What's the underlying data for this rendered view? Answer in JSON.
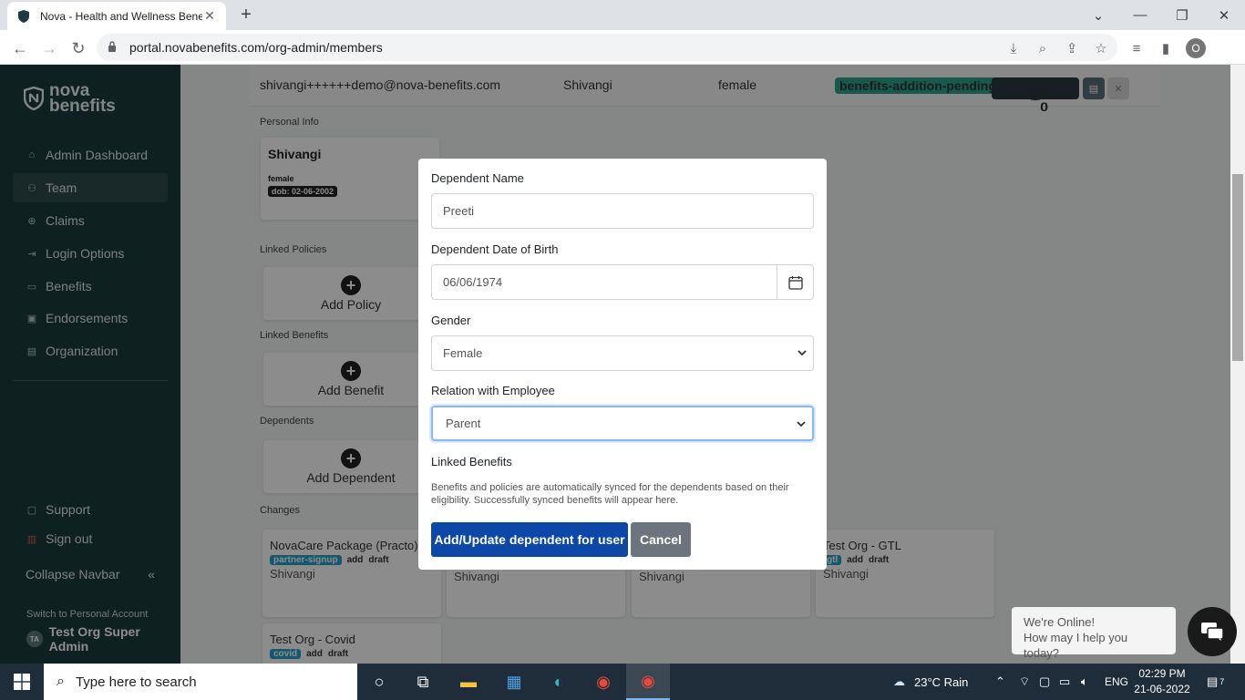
{
  "browser": {
    "tab_title": "Nova - Health and Wellness Bene",
    "url": "portal.novabenefits.com/org-admin/members",
    "profile_initial": "O"
  },
  "sidebar": {
    "logo_line1": "nova",
    "logo_line2": "benefits",
    "items": [
      {
        "label": "Admin Dashboard",
        "icon": "home-icon"
      },
      {
        "label": "Team",
        "icon": "team-icon"
      },
      {
        "label": "Claims",
        "icon": "claims-icon"
      },
      {
        "label": "Login Options",
        "icon": "login-icon"
      },
      {
        "label": "Benefits",
        "icon": "benefits-icon"
      },
      {
        "label": "Endorsements",
        "icon": "endorsements-icon"
      },
      {
        "label": "Organization",
        "icon": "organization-icon"
      }
    ],
    "support": "Support",
    "signout": "Sign out",
    "collapse": "Collapse Navbar",
    "collapse_icon": "«",
    "switch_label": "Switch to Personal Account",
    "account_initials": "TA",
    "account_name": "Test Org Super Admin"
  },
  "member_row": {
    "email": "shivangi++++++demo@nova-benefits.com",
    "name": "Shivangi",
    "gender": "female",
    "status": "benefits-addition-pending",
    "counts": [
      "0",
      "0",
      "0"
    ]
  },
  "personal": {
    "section": "Personal Info",
    "name": "Shivangi",
    "gender": "female",
    "dob": "dob: 02-06-2002"
  },
  "sections": {
    "linked_policies": "Linked Policies",
    "add_policy": "Add Policy",
    "linked_benefits": "Linked Benefits",
    "add_benefit": "Add Benefit",
    "dependents": "Dependents",
    "add_dependent": "Add Dependent",
    "changes": "Changes"
  },
  "changes": [
    {
      "title": "NovaCare Package (Practo)",
      "tag": "partner-signup",
      "op": "add",
      "state": "draft",
      "user": "Shivangi"
    },
    {
      "title": "",
      "tag": "",
      "op": "",
      "state": "",
      "user": "Shivangi"
    },
    {
      "title": "",
      "tag": "",
      "op": "",
      "state": "",
      "user": "Shivangi"
    },
    {
      "title": "Test Org - GTL",
      "tag": "gtl",
      "op": "add",
      "state": "draft",
      "user": "Shivangi"
    },
    {
      "title": "Test Org - Covid",
      "tag": "covid",
      "op": "add",
      "state": "draft",
      "user": ""
    }
  ],
  "modal": {
    "name_label": "Dependent Name",
    "name_value": "Preeti",
    "dob_label": "Dependent Date of Birth",
    "dob_value": "06/06/1974",
    "gender_label": "Gender",
    "gender_value": "Female",
    "relation_label": "Relation with Employee",
    "relation_value": "Parent",
    "linked_label": "Linked Benefits",
    "linked_help": "Benefits and policies are automatically synced for the dependents based on their eligibility. Successfully synced benefits will appear here.",
    "submit": "Add/Update dependent for user",
    "cancel": "Cancel"
  },
  "chat": {
    "line1": "We're Online!",
    "line2": "How may I help you today?"
  },
  "taskbar": {
    "search_placeholder": "Type here to search",
    "weather": "23°C  Rain",
    "lang": "ENG",
    "time": "02:29 PM",
    "date": "21-06-2022",
    "notif_count": "7"
  },
  "colors": {
    "sidebar": "#1d3b3c",
    "primary": "#0d47a8",
    "status_badge": "#2ba58a"
  }
}
